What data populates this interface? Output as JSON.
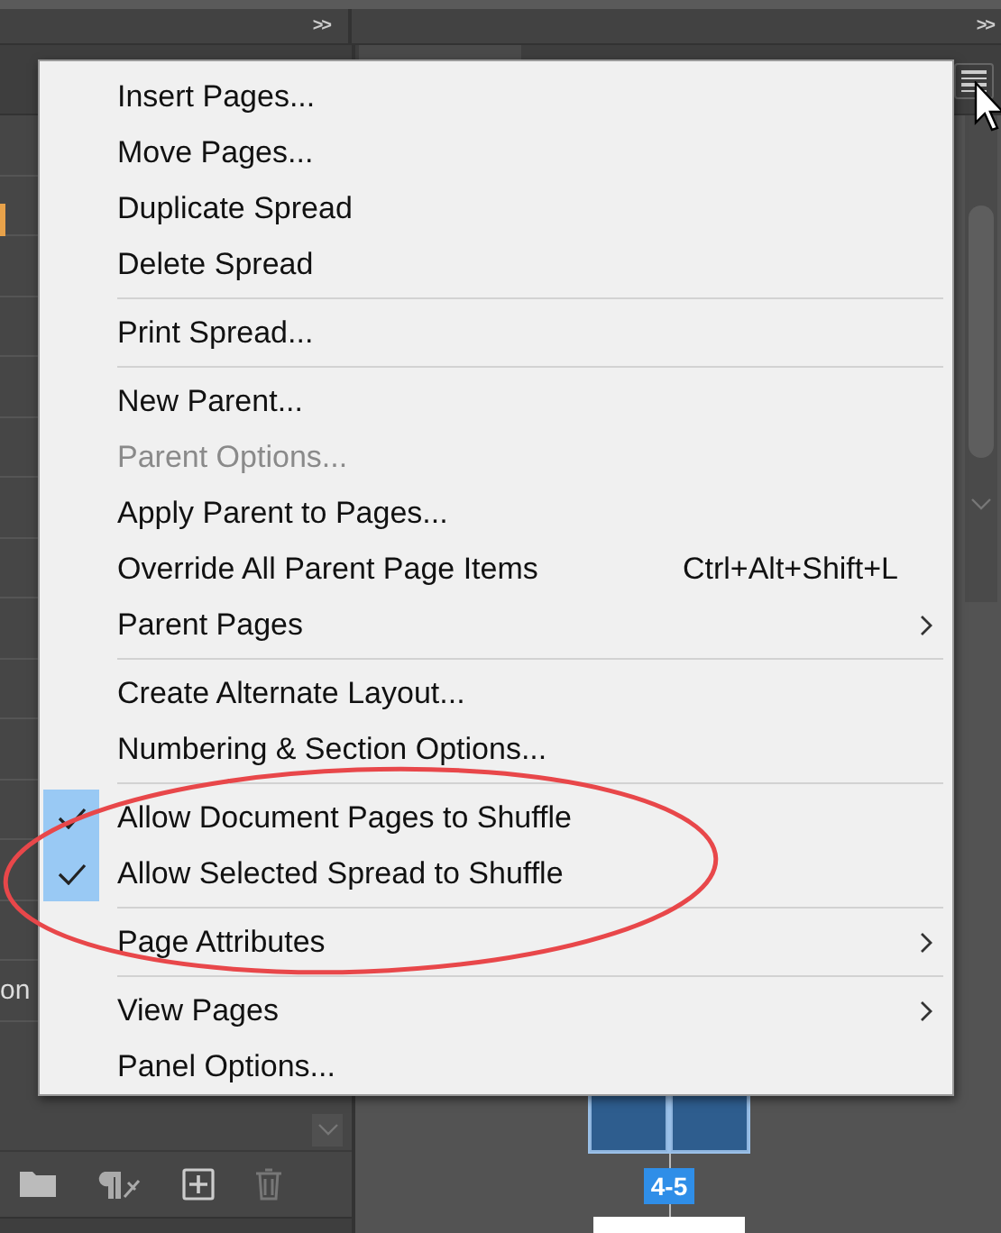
{
  "top_bar": {
    "left_collapse": ">>",
    "right_collapse": ">>"
  },
  "left_panel": {
    "partial_label": "on"
  },
  "spread": {
    "label": "4-5"
  },
  "menu": {
    "items": [
      {
        "kind": "item",
        "label": "Insert Pages...",
        "disabled": false,
        "checked": false,
        "submenu": false
      },
      {
        "kind": "item",
        "label": "Move Pages...",
        "disabled": false,
        "checked": false,
        "submenu": false
      },
      {
        "kind": "item",
        "label": "Duplicate Spread",
        "disabled": false,
        "checked": false,
        "submenu": false
      },
      {
        "kind": "item",
        "label": "Delete Spread",
        "disabled": false,
        "checked": false,
        "submenu": false
      },
      {
        "kind": "separator"
      },
      {
        "kind": "item",
        "label": "Print Spread...",
        "disabled": false,
        "checked": false,
        "submenu": false
      },
      {
        "kind": "separator"
      },
      {
        "kind": "item",
        "label": "New Parent...",
        "disabled": false,
        "checked": false,
        "submenu": false
      },
      {
        "kind": "item",
        "label": "Parent Options...",
        "disabled": true,
        "checked": false,
        "submenu": false
      },
      {
        "kind": "item",
        "label": "Apply Parent to Pages...",
        "disabled": false,
        "checked": false,
        "submenu": false
      },
      {
        "kind": "item",
        "label": "Override All Parent Page Items",
        "shortcut": "Ctrl+Alt+Shift+L",
        "disabled": false,
        "checked": false,
        "submenu": false
      },
      {
        "kind": "item",
        "label": "Parent Pages",
        "disabled": false,
        "checked": false,
        "submenu": true
      },
      {
        "kind": "separator"
      },
      {
        "kind": "item",
        "label": "Create Alternate Layout...",
        "disabled": false,
        "checked": false,
        "submenu": false
      },
      {
        "kind": "item",
        "label": "Numbering & Section Options...",
        "disabled": false,
        "checked": false,
        "submenu": false
      },
      {
        "kind": "separator"
      },
      {
        "kind": "item",
        "label": "Allow Document Pages to Shuffle",
        "disabled": false,
        "checked": true,
        "submenu": false
      },
      {
        "kind": "item",
        "label": "Allow Selected Spread to Shuffle",
        "disabled": false,
        "checked": true,
        "submenu": false
      },
      {
        "kind": "separator"
      },
      {
        "kind": "item",
        "label": "Page Attributes",
        "disabled": false,
        "checked": false,
        "submenu": true
      },
      {
        "kind": "separator"
      },
      {
        "kind": "item",
        "label": "View Pages",
        "disabled": false,
        "checked": false,
        "submenu": true
      },
      {
        "kind": "item",
        "label": "Panel Options...",
        "disabled": false,
        "checked": false,
        "submenu": false
      }
    ]
  }
}
